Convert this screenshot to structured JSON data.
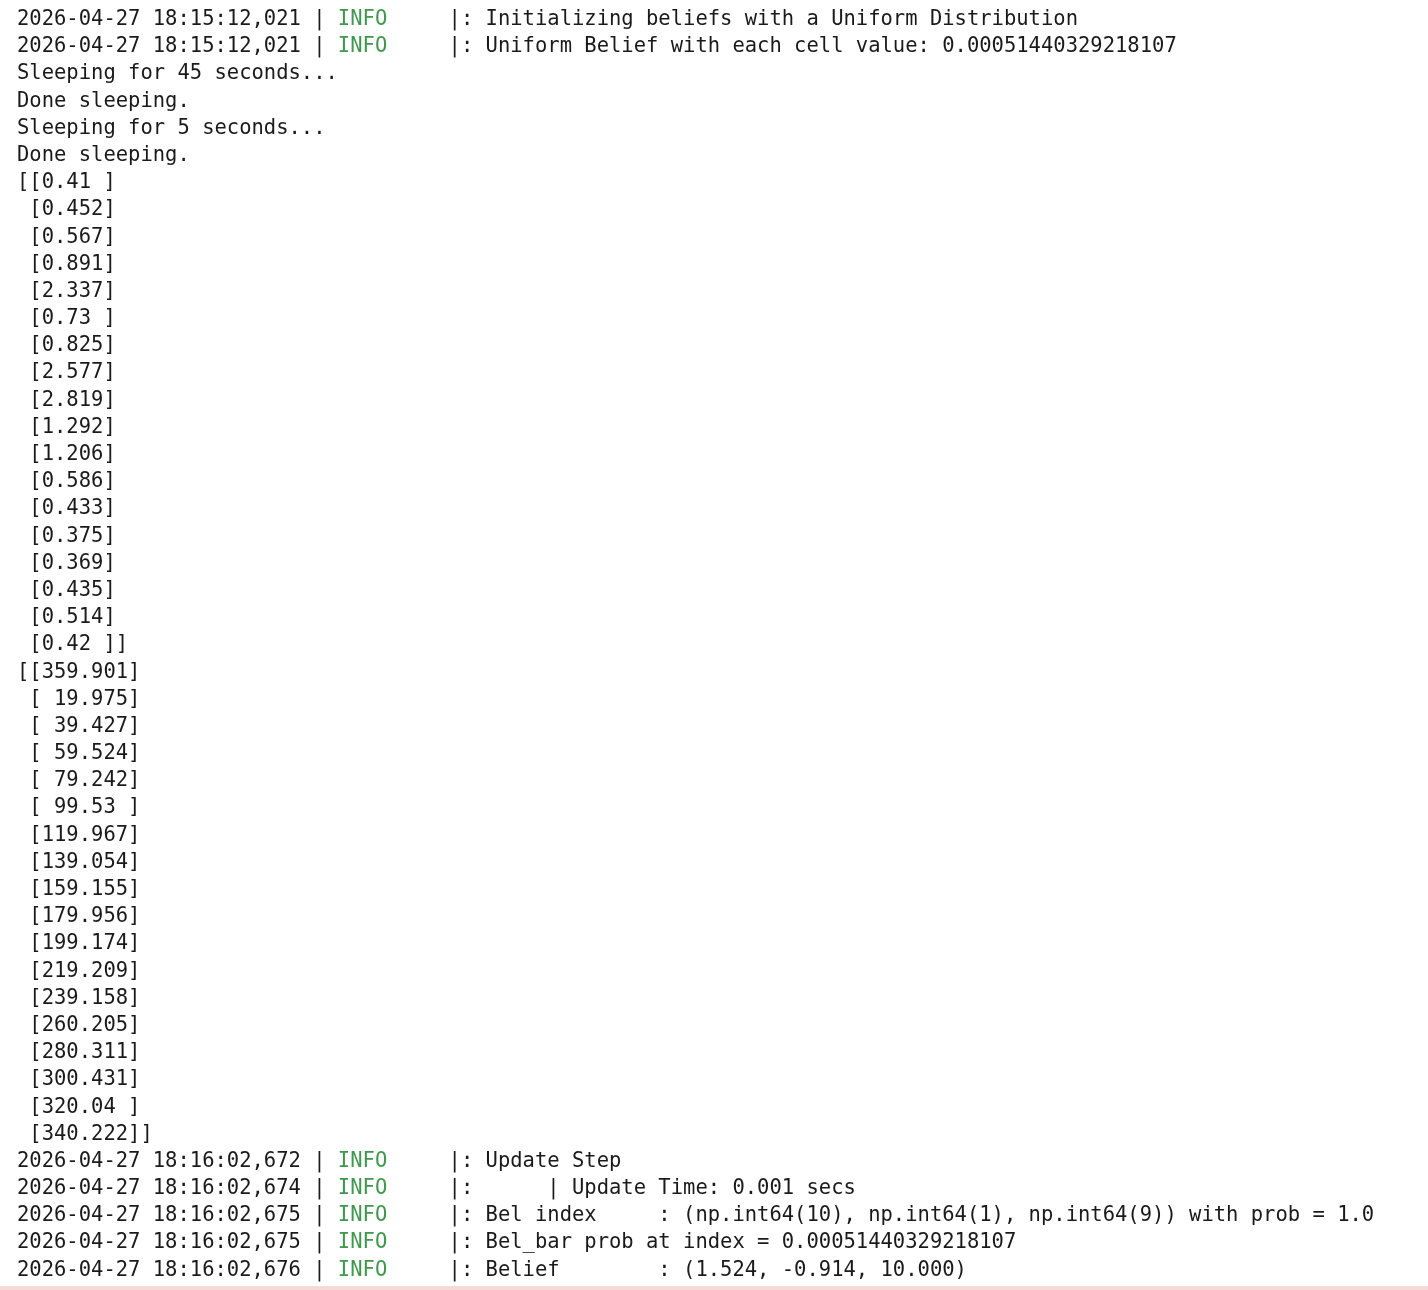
{
  "lines": [
    {
      "kind": "log",
      "timestamp": "2026-04-27 18:15:12,021 |",
      "severity": "INFO",
      "message": "|: Initializing beliefs with a Uniform Distribution"
    },
    {
      "kind": "log",
      "timestamp": "2026-04-27 18:15:12,021 |",
      "severity": "INFO",
      "message": "|: Uniform Belief with each cell value: 0.00051440329218107"
    },
    {
      "kind": "plain",
      "text": "Sleeping for 45 seconds..."
    },
    {
      "kind": "plain",
      "text": "Done sleeping."
    },
    {
      "kind": "plain",
      "text": "Sleeping for 5 seconds..."
    },
    {
      "kind": "plain",
      "text": "Done sleeping."
    },
    {
      "kind": "plain",
      "text": "[[0.41 ]"
    },
    {
      "kind": "plain",
      "text": " [0.452]"
    },
    {
      "kind": "plain",
      "text": " [0.567]"
    },
    {
      "kind": "plain",
      "text": " [0.891]"
    },
    {
      "kind": "plain",
      "text": " [2.337]"
    },
    {
      "kind": "plain",
      "text": " [0.73 ]"
    },
    {
      "kind": "plain",
      "text": " [0.825]"
    },
    {
      "kind": "plain",
      "text": " [2.577]"
    },
    {
      "kind": "plain",
      "text": " [2.819]"
    },
    {
      "kind": "plain",
      "text": " [1.292]"
    },
    {
      "kind": "plain",
      "text": " [1.206]"
    },
    {
      "kind": "plain",
      "text": " [0.586]"
    },
    {
      "kind": "plain",
      "text": " [0.433]"
    },
    {
      "kind": "plain",
      "text": " [0.375]"
    },
    {
      "kind": "plain",
      "text": " [0.369]"
    },
    {
      "kind": "plain",
      "text": " [0.435]"
    },
    {
      "kind": "plain",
      "text": " [0.514]"
    },
    {
      "kind": "plain",
      "text": " [0.42 ]]"
    },
    {
      "kind": "plain",
      "text": "[[359.901]"
    },
    {
      "kind": "plain",
      "text": " [ 19.975]"
    },
    {
      "kind": "plain",
      "text": " [ 39.427]"
    },
    {
      "kind": "plain",
      "text": " [ 59.524]"
    },
    {
      "kind": "plain",
      "text": " [ 79.242]"
    },
    {
      "kind": "plain",
      "text": " [ 99.53 ]"
    },
    {
      "kind": "plain",
      "text": " [119.967]"
    },
    {
      "kind": "plain",
      "text": " [139.054]"
    },
    {
      "kind": "plain",
      "text": " [159.155]"
    },
    {
      "kind": "plain",
      "text": " [179.956]"
    },
    {
      "kind": "plain",
      "text": " [199.174]"
    },
    {
      "kind": "plain",
      "text": " [219.209]"
    },
    {
      "kind": "plain",
      "text": " [239.158]"
    },
    {
      "kind": "plain",
      "text": " [260.205]"
    },
    {
      "kind": "plain",
      "text": " [280.311]"
    },
    {
      "kind": "plain",
      "text": " [300.431]"
    },
    {
      "kind": "plain",
      "text": " [320.04 ]"
    },
    {
      "kind": "plain",
      "text": " [340.222]]"
    },
    {
      "kind": "log",
      "timestamp": "2026-04-27 18:16:02,672 |",
      "severity": "INFO",
      "message": "|: Update Step"
    },
    {
      "kind": "log",
      "timestamp": "2026-04-27 18:16:02,674 |",
      "severity": "INFO",
      "message": "|:      | Update Time: 0.001 secs"
    },
    {
      "kind": "log",
      "timestamp": "2026-04-27 18:16:02,675 |",
      "severity": "INFO",
      "message": "|: Bel index     : (np.int64(10), np.int64(1), np.int64(9)) with prob = 1.0"
    },
    {
      "kind": "log",
      "timestamp": "2026-04-27 18:16:02,675 |",
      "severity": "INFO",
      "message": "|: Bel_bar prob at index = 0.00051440329218107"
    },
    {
      "kind": "log",
      "timestamp": "2026-04-27 18:16:02,676 |",
      "severity": "INFO",
      "message": "|: Belief        : (1.524, -0.914, 10.000)"
    }
  ]
}
